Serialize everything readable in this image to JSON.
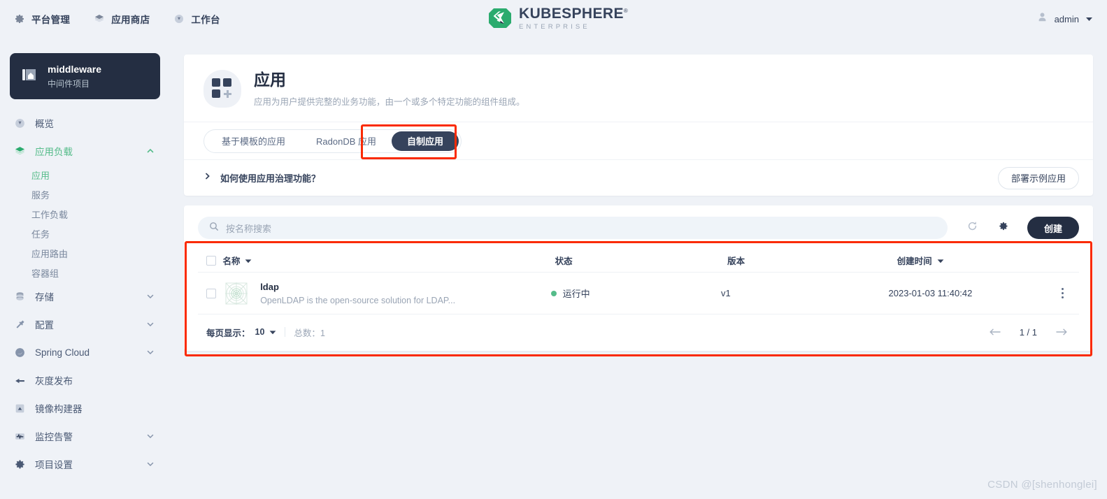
{
  "topnav": {
    "items": [
      {
        "label": "平台管理",
        "icon": "gear-icon"
      },
      {
        "label": "应用商店",
        "icon": "apps-store-icon"
      },
      {
        "label": "工作台",
        "icon": "workbench-icon"
      }
    ]
  },
  "brand": {
    "name": "KUBESPHERE",
    "registered": "®",
    "sub": "ENTERPRISE"
  },
  "user": {
    "name": "admin",
    "icon": "user-avatar-icon",
    "caret": "chevron-down-icon"
  },
  "project": {
    "name": "middleware",
    "desc": "中间件项目",
    "icon": "project-icon"
  },
  "sidebar": {
    "items": [
      {
        "label": "概览",
        "icon": "overview-icon",
        "active": false,
        "expandable": false
      },
      {
        "label": "应用负载",
        "icon": "workload-icon",
        "active": true,
        "expandable": true,
        "expanded": true,
        "children": [
          {
            "label": "应用",
            "active": true
          },
          {
            "label": "服务",
            "active": false
          },
          {
            "label": "工作负载",
            "active": false
          },
          {
            "label": "任务",
            "active": false
          },
          {
            "label": "应用路由",
            "active": false
          },
          {
            "label": "容器组",
            "active": false
          }
        ]
      },
      {
        "label": "存储",
        "icon": "storage-icon",
        "active": false,
        "expandable": true,
        "expanded": false
      },
      {
        "label": "配置",
        "icon": "config-icon",
        "active": false,
        "expandable": true,
        "expanded": false
      },
      {
        "label": "Spring Cloud",
        "icon": "spring-cloud-icon",
        "active": false,
        "expandable": true,
        "expanded": false
      },
      {
        "label": "灰度发布",
        "icon": "grayscale-release-icon",
        "active": false,
        "expandable": false
      },
      {
        "label": "镜像构建器",
        "icon": "image-builder-icon",
        "active": false,
        "expandable": false
      },
      {
        "label": "监控告警",
        "icon": "monitoring-alert-icon",
        "active": false,
        "expandable": true,
        "expanded": false
      },
      {
        "label": "项目设置",
        "icon": "project-settings-icon",
        "active": false,
        "expandable": true,
        "expanded": false
      }
    ]
  },
  "page": {
    "title": "应用",
    "desc": "应用为用户提供完整的业务功能，由一个或多个特定功能的组件组成。"
  },
  "tabs": [
    {
      "label": "基于模板的应用",
      "active": false
    },
    {
      "label": "RadonDB 应用",
      "active": false
    },
    {
      "label": "自制应用",
      "active": true
    }
  ],
  "help": {
    "text": "如何使用应用治理功能？",
    "expand_icon": "chevron-right-icon",
    "button": "部署示例应用"
  },
  "toolbar": {
    "search_placeholder": "按名称搜索",
    "search_value": "",
    "search_icon": "search-icon",
    "refresh_icon": "refresh-icon",
    "settings_icon": "gear-icon",
    "create_label": "创建"
  },
  "table": {
    "columns": [
      {
        "label": "名称",
        "sortable": true
      },
      {
        "label": "状态",
        "sortable": false
      },
      {
        "label": "版本",
        "sortable": false
      },
      {
        "label": "创建时间",
        "sortable": true
      }
    ],
    "rows": [
      {
        "name": "ldap",
        "desc": "OpenLDAP is the open-source solution for LDAP...",
        "status": "运行中",
        "status_color": "#55bc8a",
        "version": "v1",
        "created": "2023-01-03 11:40:42"
      }
    ]
  },
  "footer": {
    "per_page_label": "每页显示：",
    "per_page_value": "10",
    "total_label": "总数：",
    "total_value": "1",
    "page_indicator": "1 / 1",
    "prev_icon": "arrow-left-icon",
    "next_icon": "arrow-right-icon"
  },
  "watermark": "CSDN @[shenhonglei]",
  "colors": {
    "accent_green": "#55bc8a",
    "dark": "#242e42",
    "annotation_red": "#fa2a00"
  }
}
